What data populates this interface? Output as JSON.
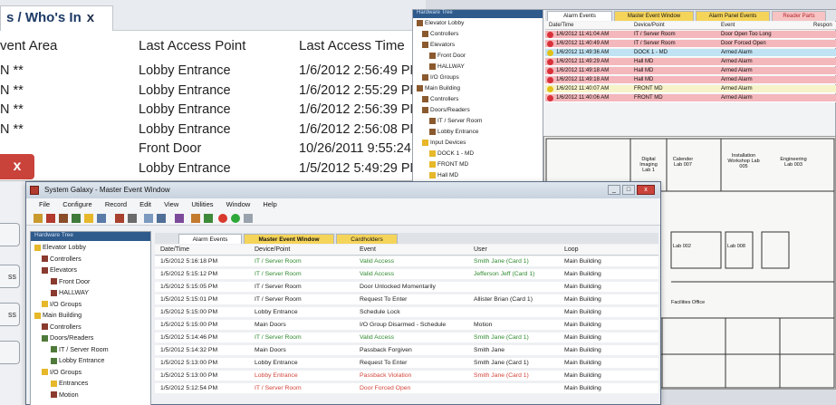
{
  "whos_in": {
    "tab_label": "s / Who's In",
    "tab_close": "x",
    "headers": [
      "vent Area",
      "Last Access Point",
      "Last Access Time"
    ],
    "rows": [
      {
        "area": "N **",
        "point": "Lobby Entrance",
        "time": "1/6/2012 2:56:49 PM"
      },
      {
        "area": "N **",
        "point": "Lobby Entrance",
        "time": "1/6/2012 2:55:29 PM"
      },
      {
        "area": "N **",
        "point": "Lobby Entrance",
        "time": "1/6/2012 2:56:39 PM"
      },
      {
        "area": "N **",
        "point": "Lobby Entrance",
        "time": "1/6/2012 2:56:08 PM"
      },
      {
        "area": "",
        "point": "Front Door",
        "time": "10/26/2011 9:55:24"
      },
      {
        "area": "",
        "point": "Lobby Entrance",
        "time": "1/5/2012 5:49:29 PM"
      }
    ]
  },
  "left_panel": {
    "close": "x",
    "buttons": [
      "",
      "ss",
      "ss",
      ""
    ]
  },
  "right_window": {
    "tree_header": "Hardware Tree",
    "tree": [
      "Elevator Lobby",
      "Controllers",
      "Elevators",
      "Front Door",
      "HALLWAY",
      "I/O Groups",
      "Main Building",
      "Controllers",
      "Doors/Readers",
      "IT / Server Room",
      "Lobby Entrance",
      "Input Devices",
      "DOCK 1 - MD",
      "FRONT MD",
      "Hall MD"
    ],
    "tabs": [
      "Alarm Events",
      "Master Event Window",
      "Alarm Panel Events",
      "Reader Parts"
    ],
    "headers": [
      "Date/Time",
      "Device/Point",
      "Event",
      "Respon"
    ],
    "rows": [
      {
        "dt": "1/6/2012 11:41:04 AM",
        "dev": "IT / Server Room",
        "ev": "Door Open Too Long",
        "color": "#d9313a",
        "bg": "#f4b7bb"
      },
      {
        "dt": "1/6/2012 11:40:49 AM",
        "dev": "IT / Server Room",
        "ev": "Door Forced Open",
        "color": "#d9313a",
        "bg": "#f4b7bb"
      },
      {
        "dt": "1/6/2012 11:49:36 AM",
        "dev": "DOCK 1 - MD",
        "ev": "Armed Alarm",
        "color": "#e2c21a",
        "bg": "#bfe3f3"
      },
      {
        "dt": "1/6/2012 11:49:29 AM",
        "dev": "Hall MD",
        "ev": "Armed Alarm",
        "color": "#d9313a",
        "bg": "#f4b7bb"
      },
      {
        "dt": "1/6/2012 11:49:18 AM",
        "dev": "Hall MD",
        "ev": "Armed Alarm",
        "color": "#d9313a",
        "bg": "#f4b7bb"
      },
      {
        "dt": "1/6/2012 11:49:18 AM",
        "dev": "Hall MD",
        "ev": "Armed Alarm",
        "color": "#d9313a",
        "bg": "#f4b7bb"
      },
      {
        "dt": "1/6/2012 11:40:07 AM",
        "dev": "FRONT MD",
        "ev": "Armed Alarm",
        "color": "#e2c21a",
        "bg": "#f7f3c9"
      },
      {
        "dt": "1/6/2012 11:40:06 AM",
        "dev": "FRONT MD",
        "ev": "Armed Alarm",
        "color": "#d9313a",
        "bg": "#f4b7bb"
      }
    ]
  },
  "floor_plan": {
    "rooms": [
      "Digital Imaging Lab 1",
      "Calender Lab 007",
      "Installation Workshop Lab 005",
      "Engineering Lab 003",
      "Lab 002",
      "Lab 008",
      "Facilities Office"
    ]
  },
  "master_window": {
    "title": "System Galaxy - Master Event Window",
    "window_buttons": [
      "_",
      "□",
      "x"
    ],
    "menu": [
      "File",
      "Configure",
      "Record",
      "Edit",
      "View",
      "Utilities",
      "Window",
      "Help"
    ],
    "tree_header": "Hardware Tree",
    "tree": [
      "Elevator Lobby",
      "Controllers",
      "Elevators",
      "Front Door",
      "HALLWAY",
      "I/O Groups",
      "Main Building",
      "Controllers",
      "Doors/Readers",
      "IT / Server Room",
      "Lobby Entrance",
      "I/O Groups",
      "Entrances",
      "Motion"
    ],
    "tabs": [
      "Alarm Events",
      "Master Event Window",
      "Cardholders"
    ],
    "headers": [
      "Date/Time",
      "Device/Point",
      "Event",
      "User",
      "Loop"
    ],
    "rows": [
      {
        "dt": "1/5/2012 5:16:18 PM",
        "dev": "IT / Server Room",
        "ev": "Valid Access",
        "user": "Smith Jane (Card 1)",
        "loop": "Main Building",
        "c": "green"
      },
      {
        "dt": "1/5/2012 5:15:12 PM",
        "dev": "IT / Server Room",
        "ev": "Valid Access",
        "user": "Jefferson Jeff (Card 1)",
        "loop": "Main Building",
        "c": "green"
      },
      {
        "dt": "1/5/2012 5:15:05 PM",
        "dev": "IT / Server Room",
        "ev": "Door Unlocked Momentarily",
        "user": "",
        "loop": "Main Building",
        "c": "dark"
      },
      {
        "dt": "1/5/2012 5:15:01 PM",
        "dev": "IT / Server Room",
        "ev": "Request To Enter",
        "user": "Allister Brian (Card 1)",
        "loop": "Main Building",
        "c": "dark"
      },
      {
        "dt": "1/5/2012 5:15:00 PM",
        "dev": "Lobby Entrance",
        "ev": "Schedule Lock",
        "user": "",
        "loop": "Main Building",
        "c": "dark"
      },
      {
        "dt": "1/5/2012 5:15:00 PM",
        "dev": "Main Doors",
        "ev": "I/O Group Disarmed - Schedule",
        "user": "Motion",
        "loop": "Main Building",
        "c": "dark"
      },
      {
        "dt": "1/5/2012 5:14:46 PM",
        "dev": "IT / Server Room",
        "ev": "Valid Access",
        "user": "Smith Jane (Card 1)",
        "loop": "Main Building",
        "c": "green"
      },
      {
        "dt": "1/5/2012 5:14:32 PM",
        "dev": "Main Doors",
        "ev": "Passback Forgiven",
        "user": "Smith Jane",
        "loop": "Main Building",
        "c": "dark"
      },
      {
        "dt": "1/5/2012 5:13:00 PM",
        "dev": "Lobby Entrance",
        "ev": "Request To Enter",
        "user": "Smith Jane (Card 1)",
        "loop": "Main Building",
        "c": "dark"
      },
      {
        "dt": "1/5/2012 5:13:00 PM",
        "dev": "Lobby Entrance",
        "ev": "Passback Violation",
        "user": "Smith Jane (Card 1)",
        "loop": "Main Building",
        "c": "red"
      },
      {
        "dt": "1/5/2012 5:12:54 PM",
        "dev": "IT / Server Room",
        "ev": "Door Forced Open",
        "user": "",
        "loop": "Main Building",
        "c": "red"
      }
    ]
  }
}
